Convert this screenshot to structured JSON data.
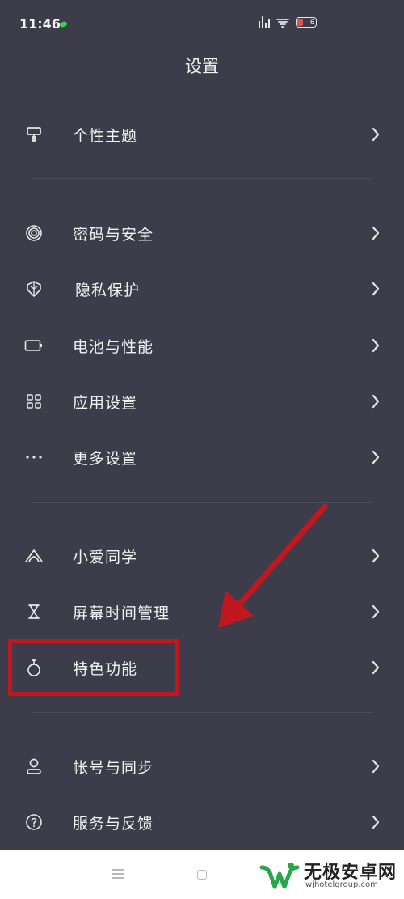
{
  "status_bar": {
    "time": "11:46",
    "battery_level": "6"
  },
  "header": {
    "title": "设置"
  },
  "settings": {
    "personal_theme": "个性主题",
    "password_security": "密码与安全",
    "privacy": "隐私保护",
    "battery_performance": "电池与性能",
    "app_settings": "应用设置",
    "more_settings": "更多设置",
    "xiaoai": "小爱同学",
    "screen_time": "屏幕时间管理",
    "special_features": "特色功能",
    "account_sync": "帐号与同步",
    "service_feedback": "服务与反馈"
  },
  "watermark": {
    "title": "无极安卓网",
    "url": "wjhotelgroup.com"
  },
  "colors": {
    "background": "#3d3c4a",
    "highlight": "#c0181e",
    "accent_green": "#3fd24f"
  }
}
